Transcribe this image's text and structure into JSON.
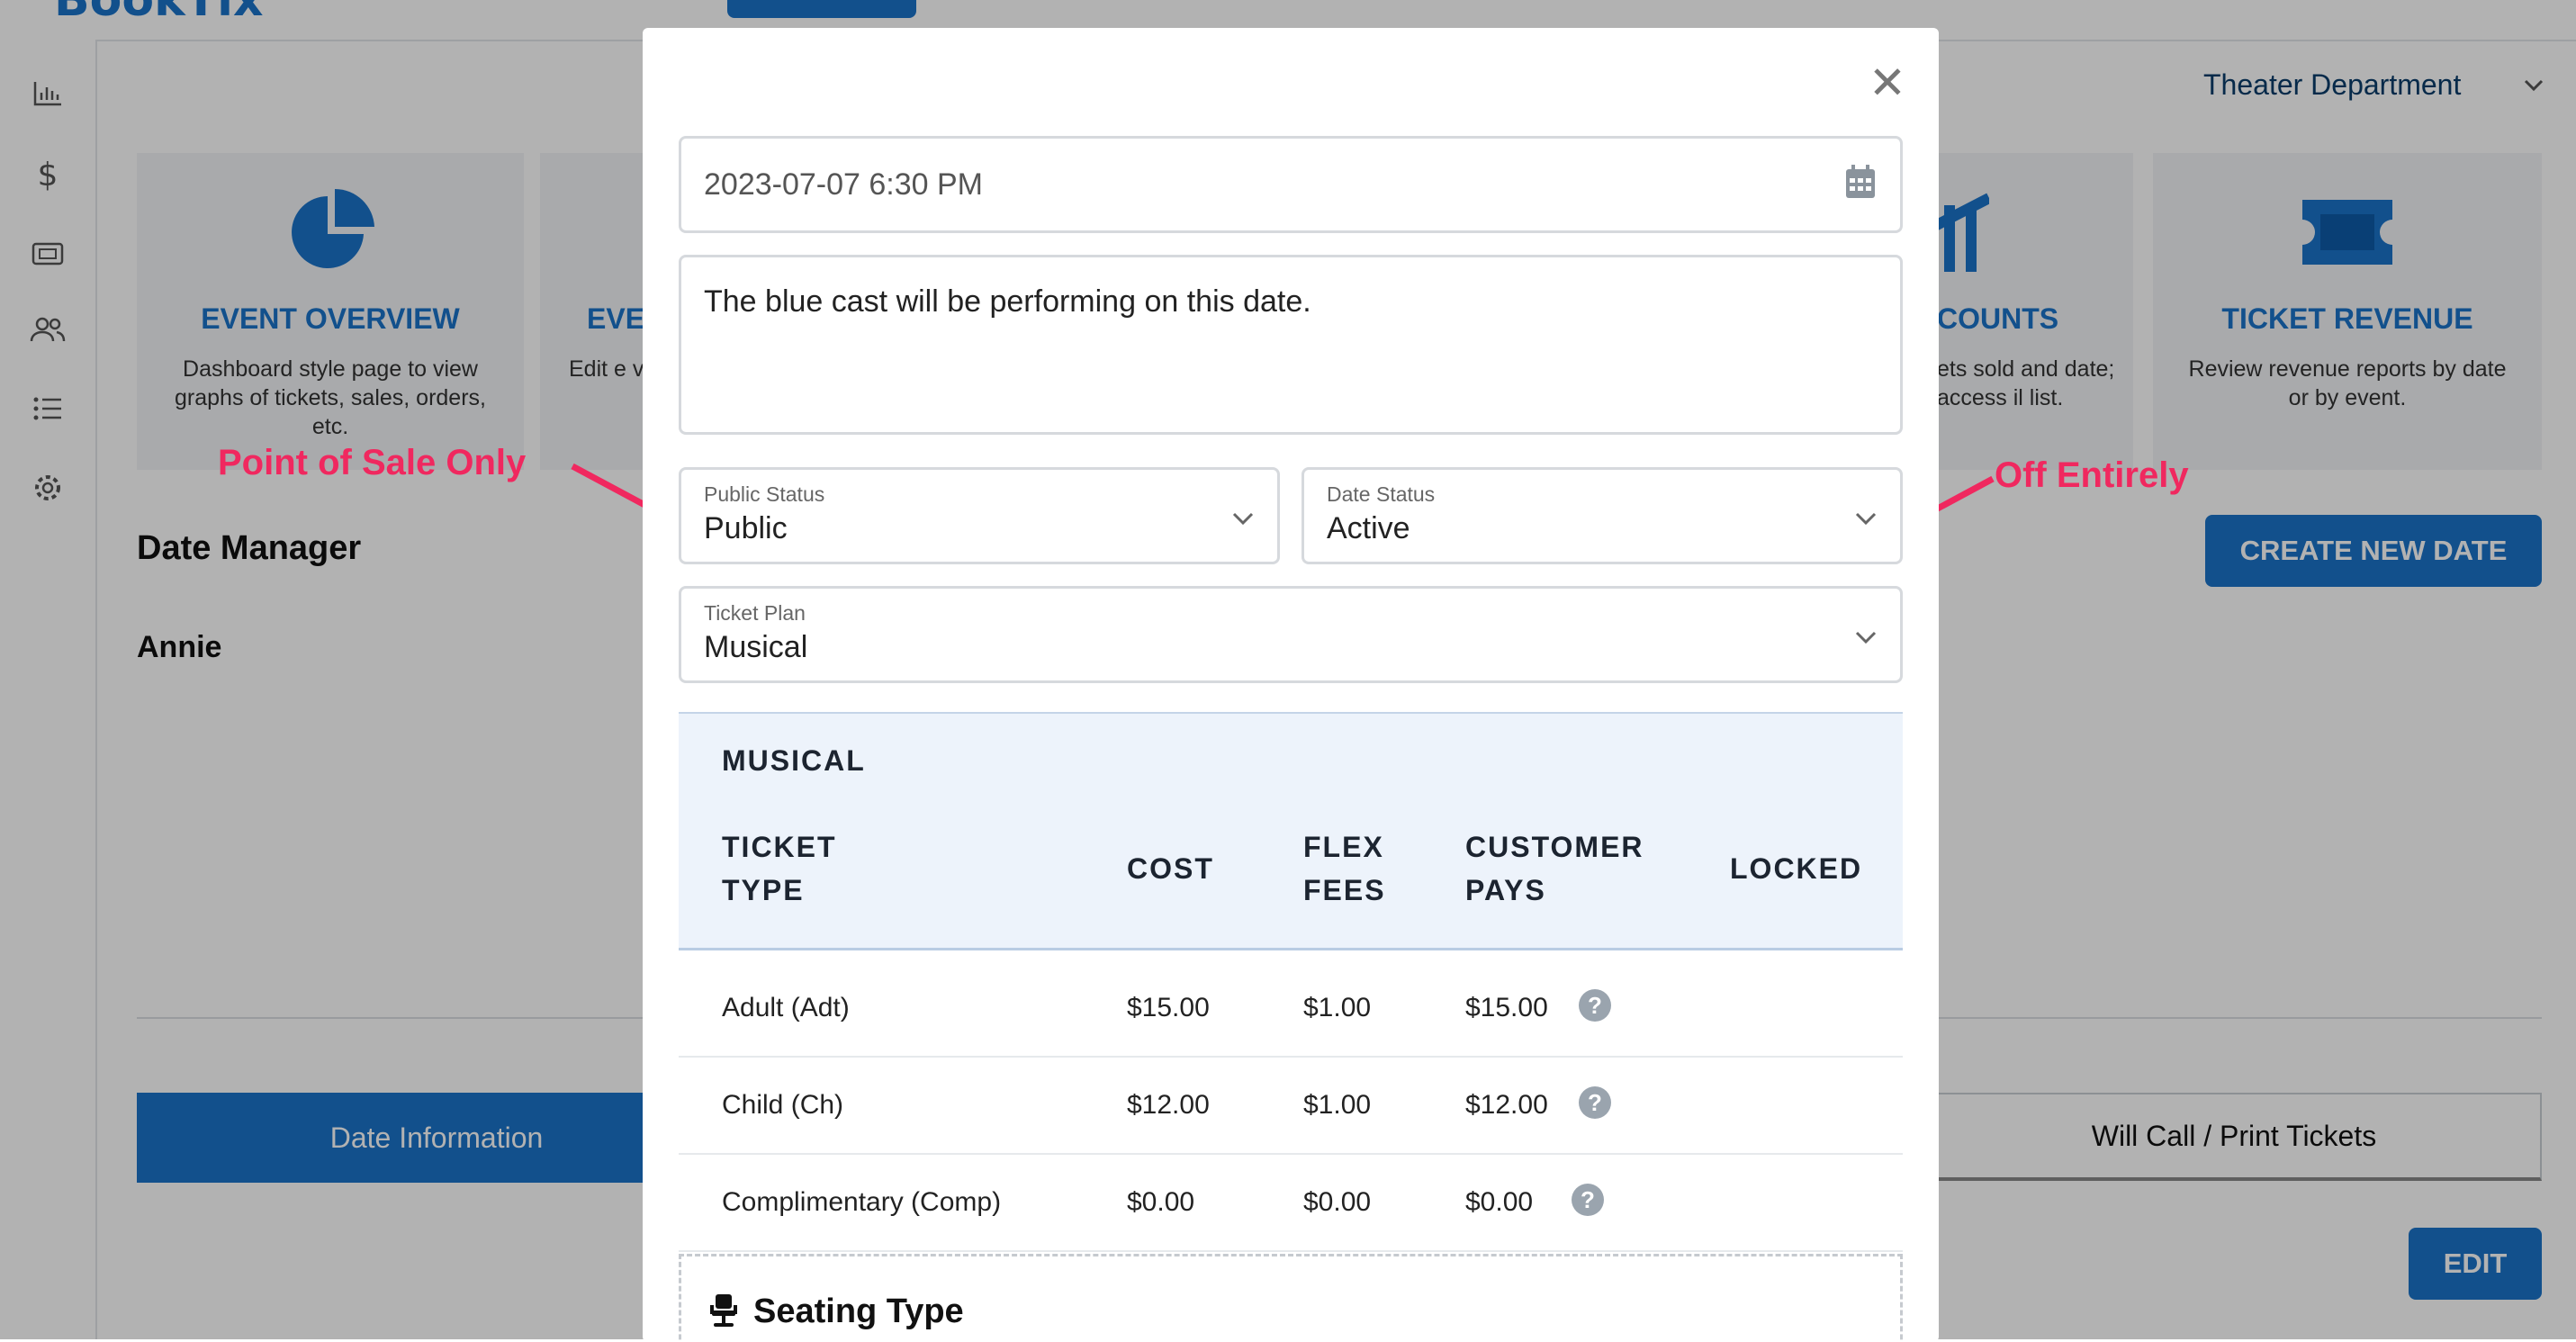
{
  "app": {
    "brand": "BookTix"
  },
  "header": {
    "department": "Theater Department"
  },
  "sidebar": {
    "icons": [
      "bar-chart-icon",
      "dollar-icon",
      "ticket-icon",
      "users-icon",
      "list-icon",
      "gear-icon"
    ]
  },
  "cards": [
    {
      "title": "EVENT OVERVIEW",
      "description": "Dashboard style page to view graphs of tickets, sales, orders, etc."
    },
    {
      "title": "EVE",
      "description": "Edit e venue,"
    },
    {
      "title": "COUNTS",
      "description": "ets sold and date; access il list."
    },
    {
      "title": "TICKET REVENUE",
      "description": "Review revenue reports by date or by event."
    }
  ],
  "main": {
    "section_title": "Date Manager",
    "show_name": "Annie",
    "create_button": "CREATE NEW DATE",
    "tabs": [
      "Date Information",
      "Will Call / Print Tickets"
    ],
    "edit_button": "EDIT"
  },
  "annotations": {
    "left": "Point of Sale Only",
    "right": "Off Entirely",
    "color": "#f0285f"
  },
  "modal": {
    "datetime_value": "2023-07-07 6:30 PM",
    "note_value": "The blue cast will be performing on this date.",
    "public_status": {
      "label": "Public Status",
      "value": "Public"
    },
    "date_status": {
      "label": "Date Status",
      "value": "Active"
    },
    "ticket_plan": {
      "label": "Ticket Plan",
      "value": "Musical"
    },
    "plan_table": {
      "plan_name": "MUSICAL",
      "headers": {
        "ticket_type_1": "TICKET",
        "ticket_type_2": "TYPE",
        "cost": "COST",
        "flex_1": "FLEX",
        "flex_2": "FEES",
        "customer_1": "CUSTOMER",
        "customer_2": "PAYS",
        "locked": "LOCKED"
      },
      "rows": [
        {
          "type": "Adult (Adt)",
          "cost": "$15.00",
          "flex": "$1.00",
          "pays": "$15.00"
        },
        {
          "type": "Child (Ch)",
          "cost": "$12.00",
          "flex": "$1.00",
          "pays": "$12.00"
        },
        {
          "type": "Complimentary (Comp)",
          "cost": "$0.00",
          "flex": "$0.00",
          "pays": "$0.00"
        }
      ]
    },
    "seating_title": "Seating Type",
    "help_glyph": "?",
    "close_glyph": "✕"
  },
  "colors": {
    "accent": "#1a73c9",
    "annotation": "#f0285f"
  }
}
